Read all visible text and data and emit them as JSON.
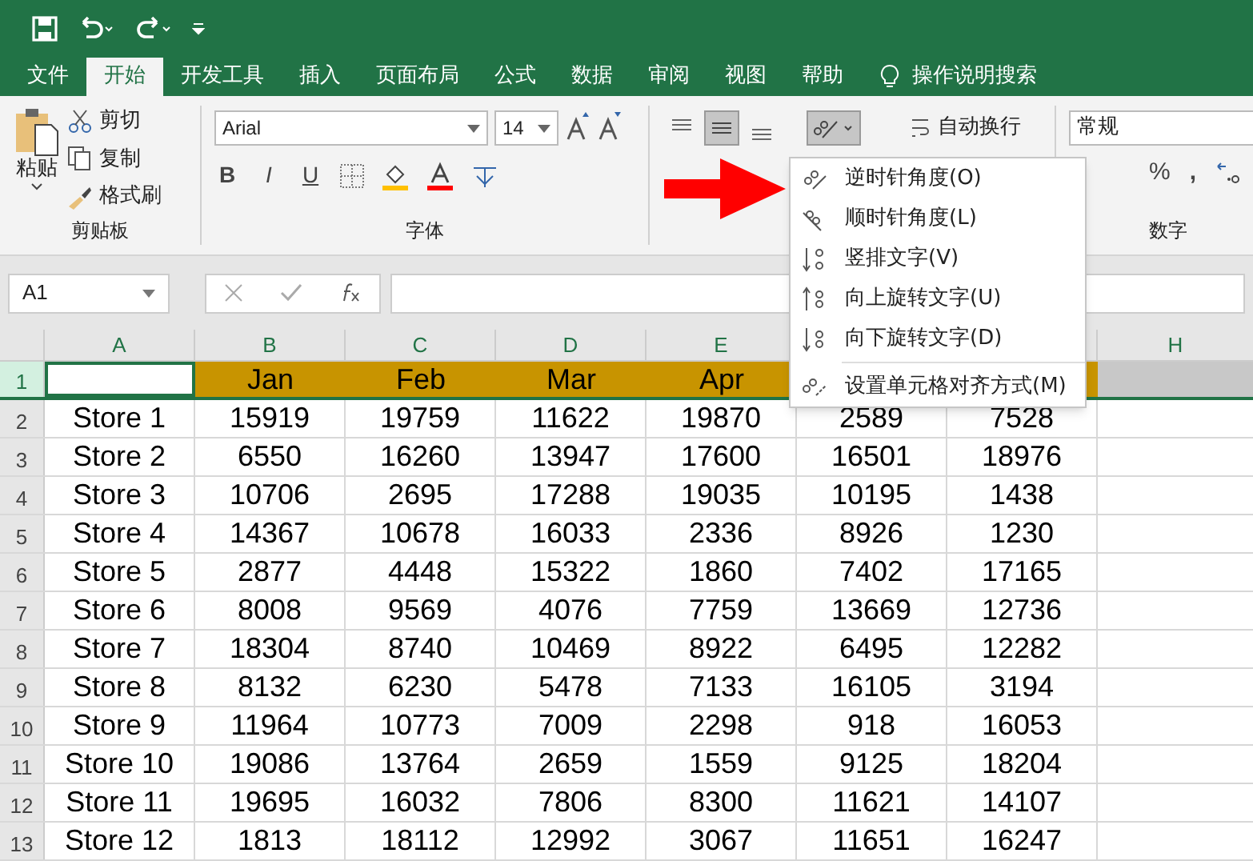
{
  "menu_tabs": [
    {
      "label": "文件",
      "selected": false
    },
    {
      "label": "开始",
      "selected": true
    },
    {
      "label": "开发工具",
      "selected": false
    },
    {
      "label": "插入",
      "selected": false
    },
    {
      "label": "页面布局",
      "selected": false
    },
    {
      "label": "公式",
      "selected": false
    },
    {
      "label": "数据",
      "selected": false
    },
    {
      "label": "审阅",
      "selected": false
    },
    {
      "label": "视图",
      "selected": false
    },
    {
      "label": "帮助",
      "selected": false
    }
  ],
  "tell_me": "操作说明搜索",
  "clipboard": {
    "paste": "粘贴",
    "cut": "剪切",
    "copy": "复制",
    "format_painter": "格式刷",
    "group": "剪贴板"
  },
  "font": {
    "name": "Arial",
    "size": "14",
    "bold": "B",
    "italic": "I",
    "underline": "U",
    "group": "字体"
  },
  "alignment": {
    "wrap_text": "自动换行"
  },
  "number": {
    "format": "常规",
    "percent": "%",
    "comma": ",",
    "group": "数字"
  },
  "name_box": "A1",
  "columns_left": [
    "A",
    "B",
    "C",
    "D",
    "E"
  ],
  "columns_right": [
    "H"
  ],
  "header_row": {
    "num": "1",
    "labels": [
      "Jan",
      "Feb",
      "Mar",
      "Apr"
    ]
  },
  "rows": [
    {
      "num": "2",
      "cells": [
        "Store 1",
        "15919",
        "19759",
        "11622",
        "19870",
        "2589",
        "7528"
      ]
    },
    {
      "num": "3",
      "cells": [
        "Store 2",
        "6550",
        "16260",
        "13947",
        "17600",
        "16501",
        "18976"
      ]
    },
    {
      "num": "4",
      "cells": [
        "Store 3",
        "10706",
        "2695",
        "17288",
        "19035",
        "10195",
        "1438"
      ]
    },
    {
      "num": "5",
      "cells": [
        "Store 4",
        "14367",
        "10678",
        "16033",
        "2336",
        "8926",
        "1230"
      ]
    },
    {
      "num": "6",
      "cells": [
        "Store 5",
        "2877",
        "4448",
        "15322",
        "1860",
        "7402",
        "17165"
      ]
    },
    {
      "num": "7",
      "cells": [
        "Store 6",
        "8008",
        "9569",
        "4076",
        "7759",
        "13669",
        "12736"
      ]
    },
    {
      "num": "8",
      "cells": [
        "Store 7",
        "18304",
        "8740",
        "10469",
        "8922",
        "6495",
        "12282"
      ]
    },
    {
      "num": "9",
      "cells": [
        "Store 8",
        "8132",
        "6230",
        "5478",
        "7133",
        "16105",
        "3194"
      ]
    },
    {
      "num": "10",
      "cells": [
        "Store 9",
        "11964",
        "10773",
        "7009",
        "2298",
        "918",
        "16053"
      ]
    },
    {
      "num": "11",
      "cells": [
        "Store 10",
        "19086",
        "13764",
        "2659",
        "1559",
        "9125",
        "18204"
      ]
    },
    {
      "num": "12",
      "cells": [
        "Store 11",
        "19695",
        "16032",
        "7806",
        "8300",
        "11621",
        "14107"
      ]
    },
    {
      "num": "13",
      "cells": [
        "Store 12",
        "1813",
        "18112",
        "12992",
        "3067",
        "11651",
        "16247"
      ]
    }
  ],
  "orientation_menu": [
    {
      "kind": "ccw",
      "label": "逆时针角度(O)"
    },
    {
      "kind": "cw",
      "label": "顺时针角度(L)"
    },
    {
      "kind": "vertical",
      "label": "竖排文字(V)"
    },
    {
      "kind": "up",
      "label": "向上旋转文字(U)"
    },
    {
      "kind": "down",
      "label": "向下旋转文字(D)"
    },
    {
      "kind": "format",
      "label": "设置单元格对齐方式(M)"
    }
  ]
}
